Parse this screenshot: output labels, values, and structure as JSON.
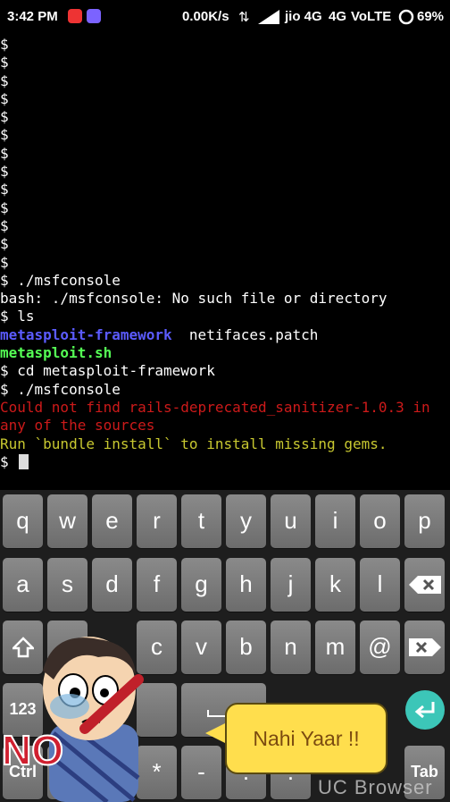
{
  "status_bar": {
    "time": "3:42 PM",
    "speed": "0.00K/s",
    "carrier": "jio 4G",
    "network": "4G",
    "volte": "VoLTE",
    "battery": "69%"
  },
  "terminal": {
    "empty_prompts": [
      "$",
      "$",
      "$",
      "$",
      "$",
      "$",
      "$",
      "$",
      "$",
      "$",
      "$",
      "$",
      "$"
    ],
    "cmd1": "$ ./msfconsole",
    "err1": "bash: ./msfconsole: No such file or directory",
    "cmd2": "$ ls",
    "ls_dir": "metasploit-framework",
    "ls_patch": "  netifaces.patch",
    "ls_sh": "metasploit.sh",
    "cmd3": "$ cd metasploit-framework",
    "cmd4": "$ ./msfconsole",
    "red1": "Could not find rails-deprecated_sanitizer-1.0.3 in",
    "red2": "any of the sources",
    "yellow": "Run `bundle install` to install missing gems.",
    "prompt": "$ "
  },
  "keyboard": {
    "row1": [
      "q",
      "w",
      "e",
      "r",
      "t",
      "y",
      "u",
      "i",
      "o",
      "p"
    ],
    "row2": [
      "a",
      "s",
      "d",
      "f",
      "g",
      "h",
      "j",
      "k",
      "l"
    ],
    "row3": [
      "c",
      "v",
      "b",
      "n",
      "m",
      "@"
    ],
    "row4_left": "123",
    "row4_mid": [
      "."
    ],
    "row5_left": "Ctrl",
    "row5_mid": [
      "*",
      "-",
      ".",
      "."
    ],
    "row5_right": "Tab"
  },
  "sticker": {
    "speech": "Nahi Yaar !!",
    "no_text": "NO"
  },
  "watermark": "UC Browser",
  "colors": {
    "accent_enter": "#3cc6b8",
    "error_red": "#cd1a1a",
    "warn_yellow": "#c8c830",
    "dir_blue": "#5b5bff",
    "exec_green": "#55ff55"
  }
}
